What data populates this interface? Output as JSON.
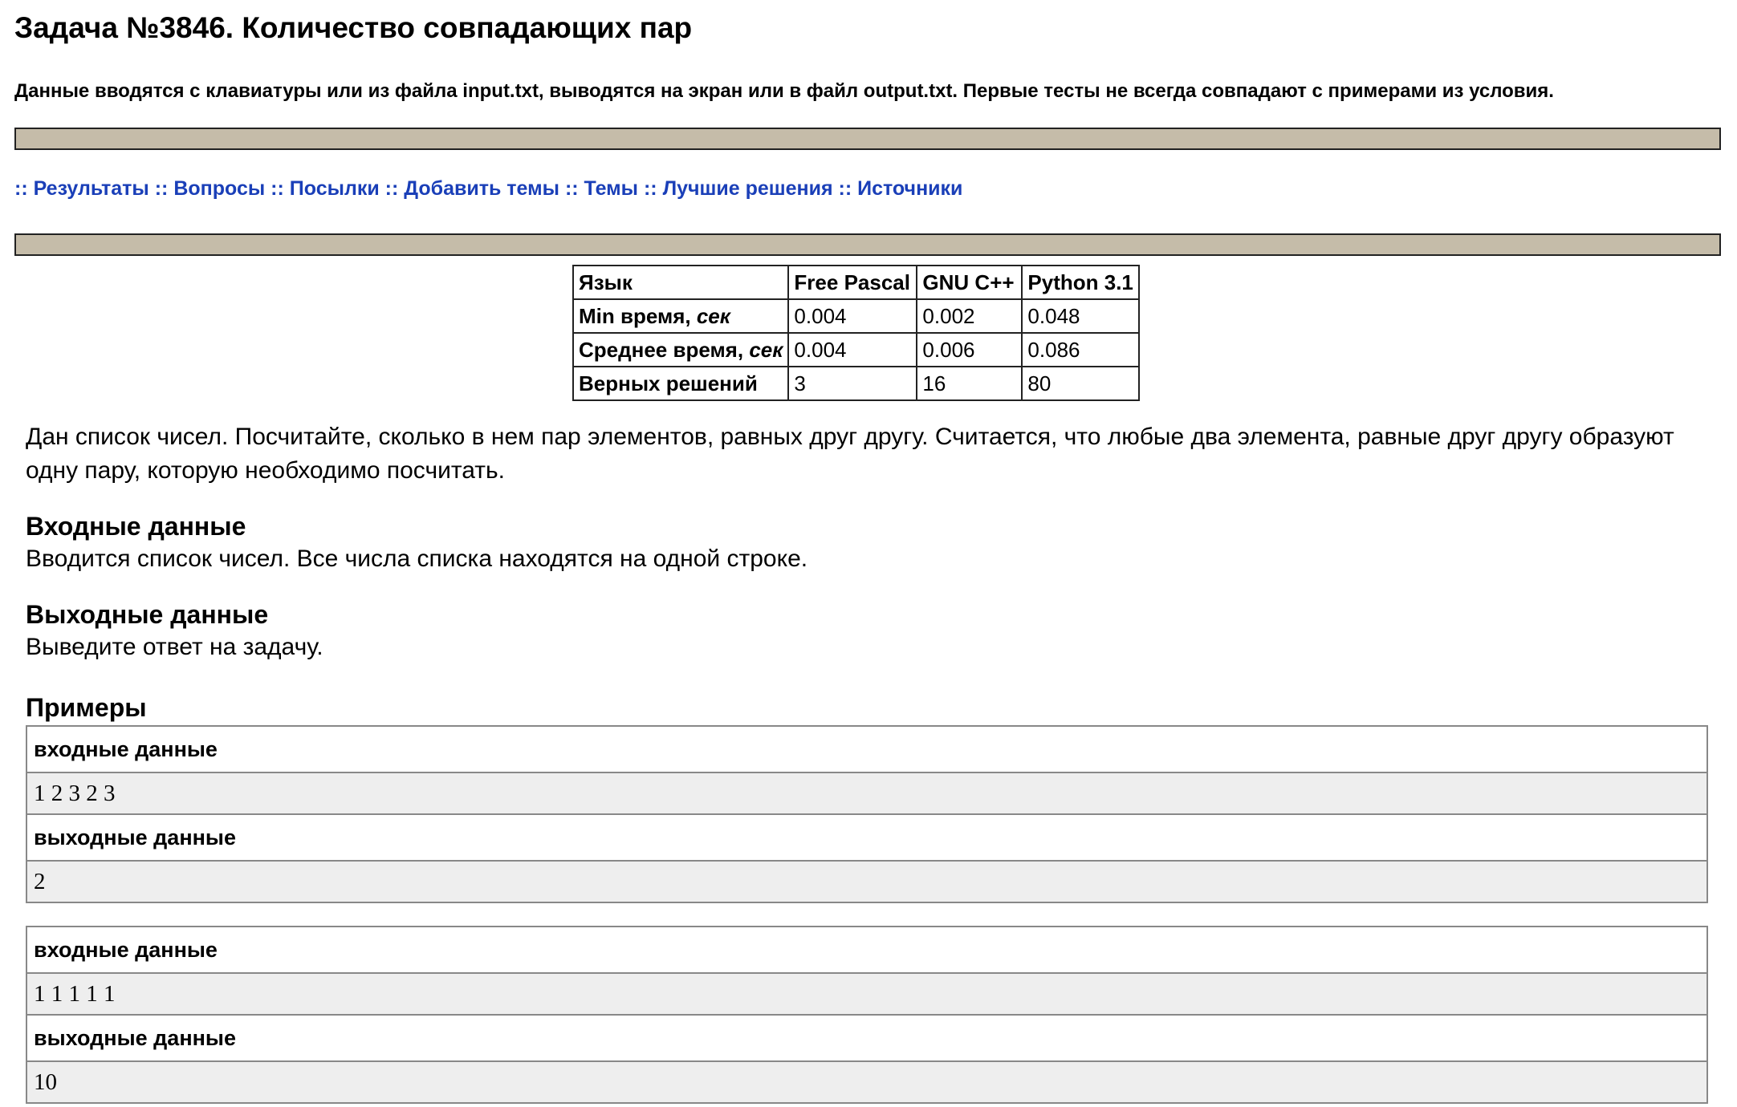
{
  "title": "Задача №3846. Количество совпадающих пар",
  "io_note": "Данные вводятся с клавиатуры или из файла input.txt, выводятся на экран или в файл output.txt. Первые тесты не всегда совпадают с примерами из условия.",
  "nav": {
    "separator": "::",
    "links": [
      "Результаты",
      "Вопросы",
      "Посылки",
      "Добавить темы",
      "Темы",
      "Лучшие решения",
      "Источники"
    ]
  },
  "stats": {
    "header": [
      "Язык",
      "Free Pascal",
      "GNU C++",
      "Python 3.1"
    ],
    "rows": [
      {
        "label": "Min время, ",
        "label_em": "сек",
        "values": [
          "0.004",
          "0.002",
          "0.048"
        ]
      },
      {
        "label": "Среднее время, ",
        "label_em": "сек",
        "values": [
          "0.004",
          "0.006",
          "0.086"
        ]
      },
      {
        "label": "Верных решений",
        "label_em": "",
        "values": [
          "3",
          "16",
          "80"
        ]
      }
    ]
  },
  "legend": "Дан список чисел. Посчитайте, сколько в нем пар элементов, равных друг другу. Считается, что любые два элемента, равные друг другу образуют одну пару, которую необходимо посчитать.",
  "input_section": {
    "heading": "Входные данные",
    "text": "Вводится список чисел. Все числа списка находятся на одной строке."
  },
  "output_section": {
    "heading": "Выходные данные",
    "text": "Выведите ответ на задачу."
  },
  "examples": {
    "heading": "Примеры",
    "input_label": "входные данные",
    "output_label": "выходные данные",
    "items": [
      {
        "input": "1 2 3 2 3",
        "output": "2"
      },
      {
        "input": "1 1 1 1 1",
        "output": "10"
      }
    ]
  }
}
